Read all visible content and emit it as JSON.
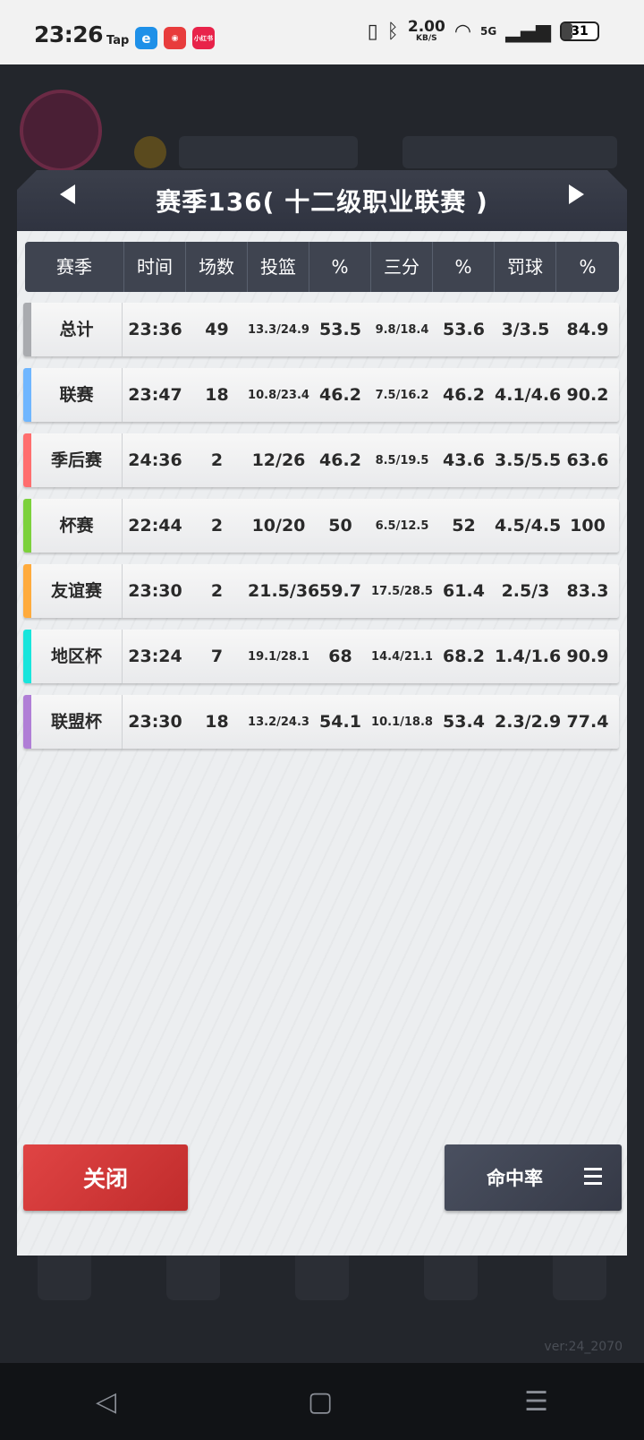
{
  "status_bar": {
    "time": "23:26",
    "app_tap": "Tap",
    "app_red": "小红书",
    "speed_value": "2.00",
    "speed_unit": "KB/S",
    "network": "5G",
    "battery": "31",
    "battery_level": 0.31
  },
  "dialog": {
    "title": "赛季136( 十二级职业联赛 )",
    "columns": [
      "赛季",
      "时间",
      "场数",
      "投篮",
      "%",
      "三分",
      "%",
      "罚球",
      "%"
    ],
    "rows": [
      {
        "name": "总计",
        "accent": "#a9abaf",
        "cells": [
          "23:36",
          "49",
          "13.3/24.9",
          "53.5",
          "9.8/18.4",
          "53.6",
          "3/3.5",
          "84.9"
        ]
      },
      {
        "name": "联赛",
        "accent": "#6fb6ff",
        "cells": [
          "23:47",
          "18",
          "10.8/23.4",
          "46.2",
          "7.5/16.2",
          "46.2",
          "4.1/4.6",
          "90.2"
        ]
      },
      {
        "name": "季后赛",
        "accent": "#ff6e6e",
        "cells": [
          "24:36",
          "2",
          "12/26",
          "46.2",
          "8.5/19.5",
          "43.6",
          "3.5/5.5",
          "63.6"
        ]
      },
      {
        "name": "杯赛",
        "accent": "#7cd13c",
        "cells": [
          "22:44",
          "2",
          "10/20",
          "50",
          "6.5/12.5",
          "52",
          "4.5/4.5",
          "100"
        ]
      },
      {
        "name": "友谊赛",
        "accent": "#ffab3d",
        "cells": [
          "23:30",
          "2",
          "21.5/36",
          "59.7",
          "17.5/28.5",
          "61.4",
          "2.5/3",
          "83.3"
        ]
      },
      {
        "name": "地区杯",
        "accent": "#19e5dc",
        "cells": [
          "23:24",
          "7",
          "19.1/28.1",
          "68",
          "14.4/21.1",
          "68.2",
          "1.4/1.6",
          "90.9"
        ]
      },
      {
        "name": "联盟杯",
        "accent": "#b07ed6",
        "cells": [
          "23:30",
          "18",
          "13.2/24.3",
          "54.1",
          "10.1/18.8",
          "53.4",
          "2.3/2.9",
          "77.4"
        ]
      }
    ],
    "close_label": "关闭",
    "rate_label": "命中率"
  },
  "version": "ver:24_2070"
}
